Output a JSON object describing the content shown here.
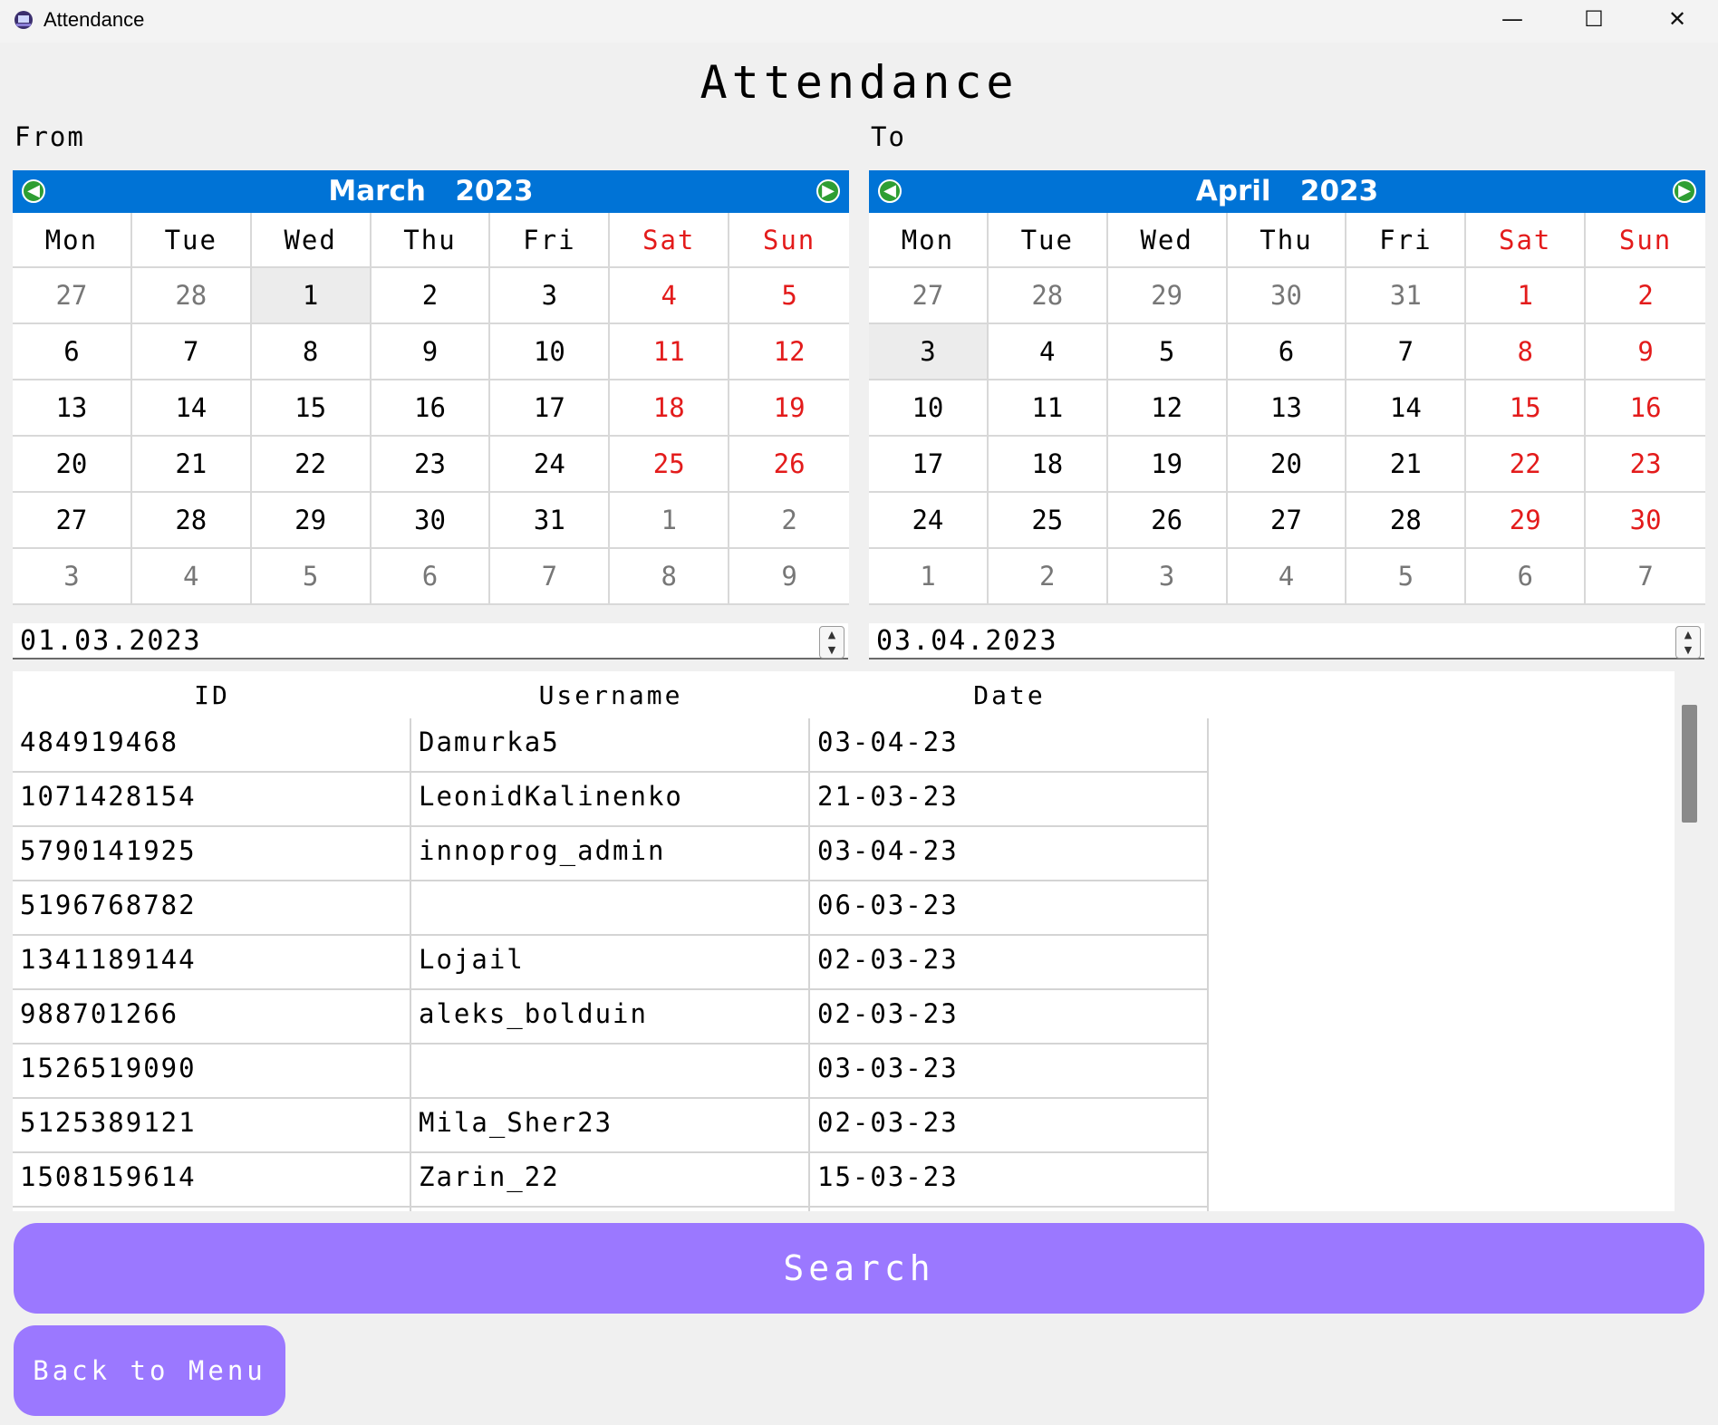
{
  "window": {
    "title": "Attendance",
    "minimize_glyph": "—",
    "maximize_glyph": "☐",
    "close_glyph": "✕"
  },
  "page_title": "Attendance",
  "from_label": "From",
  "to_label": "To",
  "calendars": [
    {
      "month": "March",
      "year": "2023",
      "weekdays": [
        "Mon",
        "Tue",
        "Wed",
        "Thu",
        "Fri",
        "Sat",
        "Sun"
      ],
      "weeks": [
        [
          "27",
          "28",
          "1",
          "2",
          "3",
          "4",
          "5"
        ],
        [
          "6",
          "7",
          "8",
          "9",
          "10",
          "11",
          "12"
        ],
        [
          "13",
          "14",
          "15",
          "16",
          "17",
          "18",
          "19"
        ],
        [
          "20",
          "21",
          "22",
          "23",
          "24",
          "25",
          "26"
        ],
        [
          "27",
          "28",
          "29",
          "30",
          "31",
          "1",
          "2"
        ],
        [
          "3",
          "4",
          "5",
          "6",
          "7",
          "8",
          "9"
        ]
      ],
      "other_month": [
        [
          0,
          0
        ],
        [
          0,
          1
        ],
        [
          4,
          5
        ],
        [
          4,
          6
        ],
        [
          5,
          0
        ],
        [
          5,
          1
        ],
        [
          5,
          2
        ],
        [
          5,
          3
        ],
        [
          5,
          4
        ],
        [
          5,
          5
        ],
        [
          5,
          6
        ]
      ],
      "selected": [
        0,
        2
      ]
    },
    {
      "month": "April",
      "year": "2023",
      "weekdays": [
        "Mon",
        "Tue",
        "Wed",
        "Thu",
        "Fri",
        "Sat",
        "Sun"
      ],
      "weeks": [
        [
          "27",
          "28",
          "29",
          "30",
          "31",
          "1",
          "2"
        ],
        [
          "3",
          "4",
          "5",
          "6",
          "7",
          "8",
          "9"
        ],
        [
          "10",
          "11",
          "12",
          "13",
          "14",
          "15",
          "16"
        ],
        [
          "17",
          "18",
          "19",
          "20",
          "21",
          "22",
          "23"
        ],
        [
          "24",
          "25",
          "26",
          "27",
          "28",
          "29",
          "30"
        ],
        [
          "1",
          "2",
          "3",
          "4",
          "5",
          "6",
          "7"
        ]
      ],
      "other_month": [
        [
          0,
          0
        ],
        [
          0,
          1
        ],
        [
          0,
          2
        ],
        [
          0,
          3
        ],
        [
          0,
          4
        ],
        [
          5,
          0
        ],
        [
          5,
          1
        ],
        [
          5,
          2
        ],
        [
          5,
          3
        ],
        [
          5,
          4
        ],
        [
          5,
          5
        ],
        [
          5,
          6
        ]
      ],
      "selected": [
        1,
        0
      ]
    }
  ],
  "from_date": "01.03.2023",
  "to_date": "03.04.2023",
  "table": {
    "columns": [
      "ID",
      "Username",
      "Date"
    ],
    "rows": [
      [
        "484919468",
        "Damurka5",
        "03-04-23"
      ],
      [
        "1071428154",
        "LeonidKalinenko",
        "21-03-23"
      ],
      [
        "5790141925",
        "innoprog_admin",
        "03-04-23"
      ],
      [
        "5196768782",
        "",
        "06-03-23"
      ],
      [
        "1341189144",
        "Lojail",
        "02-03-23"
      ],
      [
        "988701266",
        "aleks_bolduin",
        "02-03-23"
      ],
      [
        "1526519090",
        "",
        "03-03-23"
      ],
      [
        "5125389121",
        "Mila_Sher23",
        "02-03-23"
      ],
      [
        "1508159614",
        "Zarin_22",
        "15-03-23"
      ]
    ]
  },
  "search_label": "Search",
  "back_label": "Back to Menu",
  "colors": {
    "calendar_header": "#0073d6",
    "weekend": "#e31b1b",
    "button": "#9b78ff",
    "nav_arrow": "#2e9e33"
  }
}
